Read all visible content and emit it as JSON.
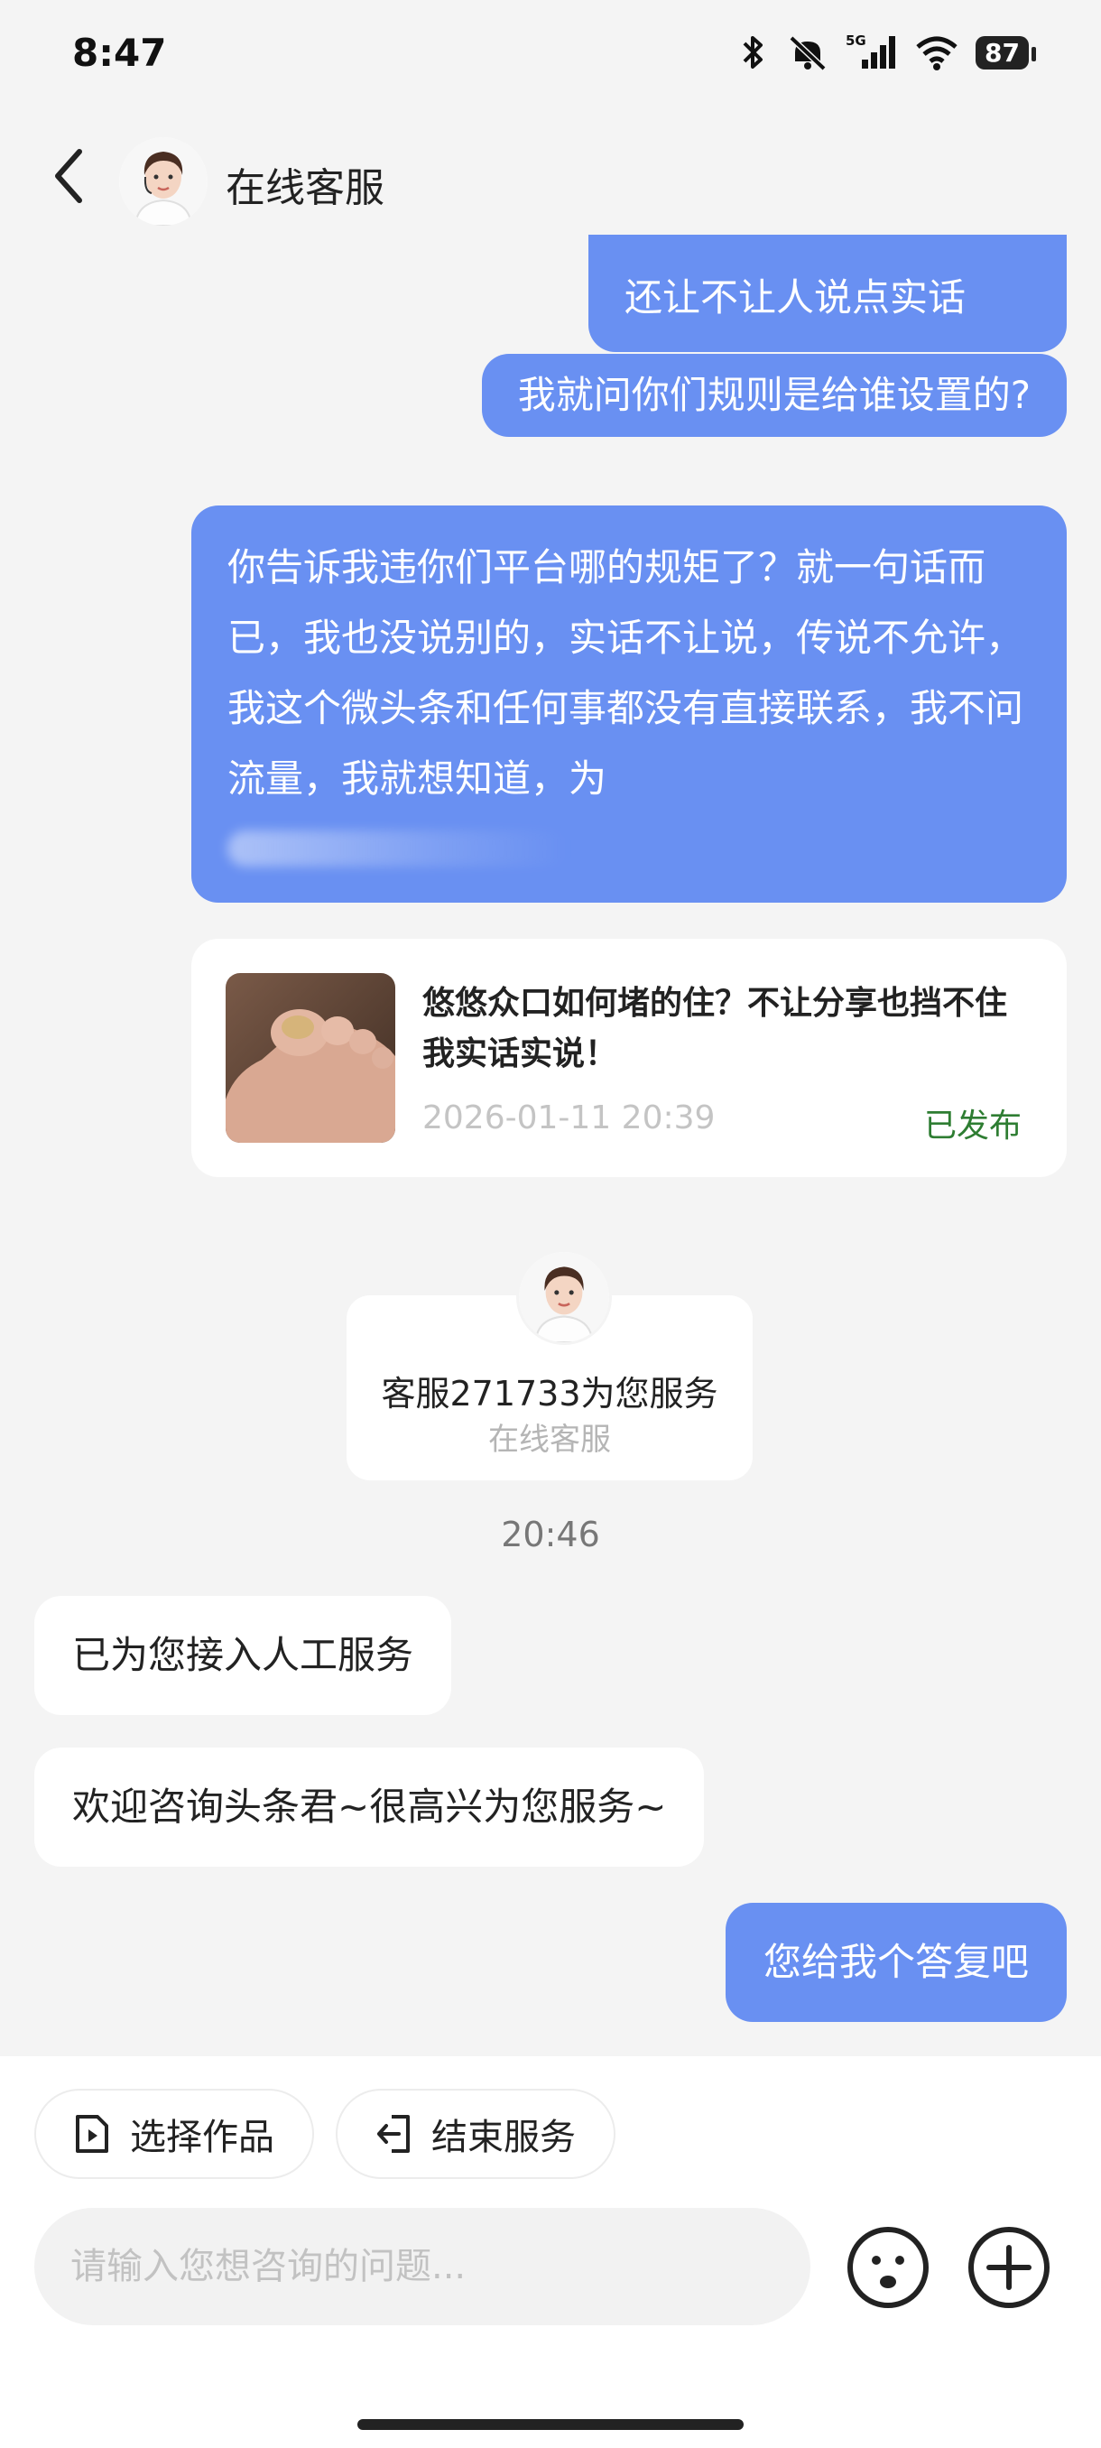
{
  "status_bar": {
    "time": "8:47",
    "battery": "87",
    "network": "5G"
  },
  "header": {
    "title": "在线客服"
  },
  "messages": {
    "m1": "还让不让人说点实话",
    "m2": "我就问你们规则是给谁设置的?",
    "m3": "你告诉我违你们平台哪的规矩了？就一句话而已，我也没说别的，实话不让说，传说不允许，我这个微头条和任何事都没有直接联系，我不问流量，我就想知道，为",
    "work_card": {
      "title": "悠悠众口如何堵的住？不让分享也挡不住我实话实说！",
      "date": "2026-01-11 20:39",
      "status": "已发布"
    },
    "agent_card": {
      "name": "客服271733为您服务",
      "role": "在线客服"
    },
    "timestamp": "20:46",
    "m4": "已为您接入人工服务",
    "m5": "欢迎咨询头条君~很高兴为您服务~",
    "m6": "您给我个答复吧"
  },
  "bottom": {
    "chip_select": "选择作品",
    "chip_end": "结束服务",
    "input_placeholder": "请输入您想咨询的问题..."
  },
  "colors": {
    "bubble_right": "#6990f2",
    "bubble_left": "#ffffff",
    "background": "#f4f4f4",
    "status_published": "#2e7d32"
  },
  "icons": [
    "back-arrow-icon",
    "bluetooth-icon",
    "mute-icon",
    "signal-icon",
    "wifi-icon",
    "battery-icon",
    "work-icon",
    "exit-icon",
    "emoji-icon",
    "plus-icon"
  ]
}
